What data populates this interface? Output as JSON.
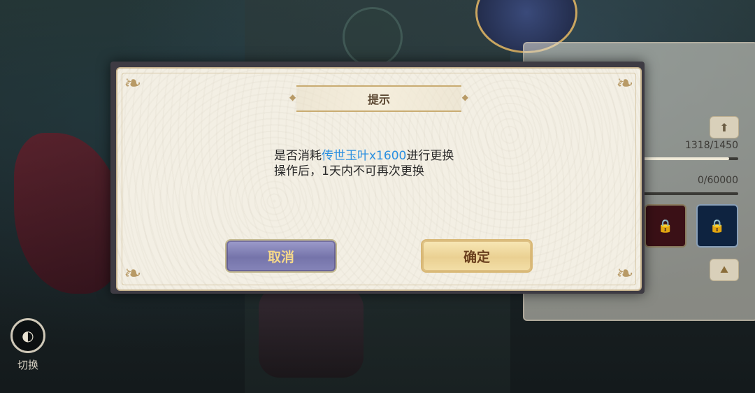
{
  "dialog": {
    "title": "提示",
    "line1_prefix": "是否消耗",
    "line1_highlight": "传世玉叶x1600",
    "line1_suffix": "进行更换",
    "line2": "操作后，1天内不可再次更换",
    "cancel_label": "取消",
    "confirm_label": "确定"
  },
  "side_panel": {
    "stat1": "1318/1450",
    "stat1_fill": 0.909,
    "stat2": "0/60000",
    "stat2_fill": 0
  },
  "switch": {
    "label": "切换"
  },
  "colors": {
    "highlight": "#2a8fe0",
    "cancel_button": "#7574aa",
    "confirm_button": "#ead092"
  }
}
